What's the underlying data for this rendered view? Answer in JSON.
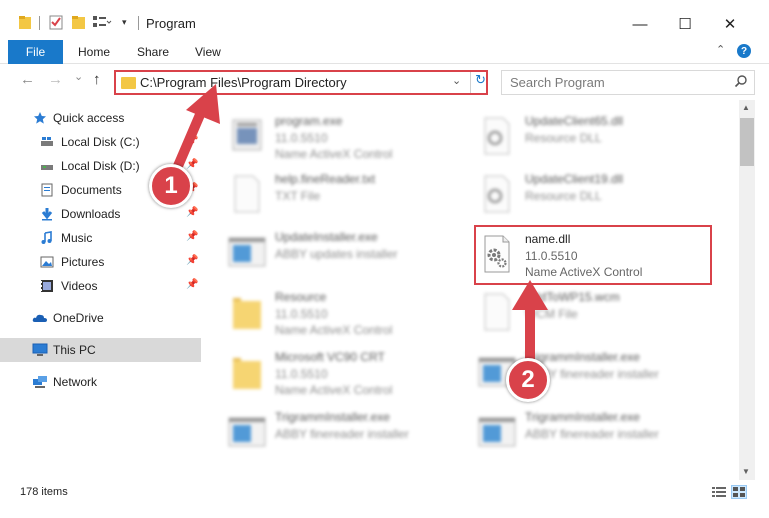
{
  "window": {
    "title": "Program",
    "minimize_glyph": "—",
    "maximize_glyph": "☐",
    "close_glyph": "✕"
  },
  "ribbon": {
    "tabs": [
      "File",
      "Home",
      "Share",
      "View"
    ]
  },
  "nav": {
    "back_glyph": "←",
    "forward_glyph": "→",
    "recent_glyph": "⌄",
    "up_glyph": "↑",
    "address": "C:\\Program Files\\Program Directory",
    "search_placeholder": "Search Program"
  },
  "sidebar": {
    "items": [
      {
        "label": "Quick access",
        "icon": "star-icon",
        "pinned": false
      },
      {
        "label": "Local Disk (C:)",
        "icon": "drive-icon",
        "pinned": true
      },
      {
        "label": "Local Disk (D:)",
        "icon": "drive-icon",
        "pinned": true
      },
      {
        "label": "Documents",
        "icon": "documents-icon",
        "pinned": true
      },
      {
        "label": "Downloads",
        "icon": "downloads-icon",
        "pinned": true
      },
      {
        "label": "Music",
        "icon": "music-icon",
        "pinned": true
      },
      {
        "label": "Pictures",
        "icon": "pictures-icon",
        "pinned": true
      },
      {
        "label": "Videos",
        "icon": "videos-icon",
        "pinned": true
      },
      {
        "label": "OneDrive",
        "icon": "cloud-icon",
        "pinned": false
      },
      {
        "label": "This PC",
        "icon": "computer-icon",
        "pinned": false
      },
      {
        "label": "Network",
        "icon": "network-icon",
        "pinned": false
      }
    ],
    "pin_glyph": "📌"
  },
  "files": {
    "left": [
      {
        "name": "program.exe",
        "line2": "11.0.5510",
        "line3": "Name ActiveX Control",
        "icon": "exe-icon"
      },
      {
        "name": "help.fineReader.txt",
        "line2": "TXT File",
        "line3": "",
        "icon": "text-file-icon"
      },
      {
        "name": "UpdateInstaller.exe",
        "line2": "ABBY updates installer",
        "line3": "",
        "icon": "installer-icon"
      },
      {
        "name": "Resource",
        "line2": "11.0.5510",
        "line3": "Name ActiveX Control",
        "icon": "folder-icon"
      },
      {
        "name": "Microsoft VC90 CRT",
        "line2": "11.0.5510",
        "line3": "Name ActiveX Control",
        "icon": "folder-icon"
      },
      {
        "name": "TrigrammInstaller.exe",
        "line2": "ABBY finereader installer",
        "line3": "",
        "icon": "installer-icon"
      }
    ],
    "right": [
      {
        "name": "UpdateClient65.dll",
        "line2": "Resource DLL",
        "line3": "",
        "icon": "dll-icon"
      },
      {
        "name": "UpdateClient19.dll",
        "line2": "Resource DLL",
        "line3": "",
        "icon": "dll-icon"
      },
      {
        "name": "name.dll",
        "line2": "11.0.5510",
        "line3": "Name ActiveX Control",
        "icon": "dll-gear-icon"
      },
      {
        "name": "AddToWP15.wcm",
        "line2": "WCM File",
        "line3": "",
        "icon": "file-icon"
      },
      {
        "name": "TrigrammInstaller.exe",
        "line2": "ABBY finereader installer",
        "line3": "",
        "icon": "installer-icon"
      },
      {
        "name": "TrigrammInstaller.exe",
        "line2": "ABBY finereader installer",
        "line3": "",
        "icon": "installer-icon"
      }
    ]
  },
  "status": {
    "item_count": "178 items"
  },
  "callouts": [
    "1",
    "2"
  ],
  "colors": {
    "accent": "#1979ca",
    "highlight": "#d9424a",
    "selected": "#cce8ff"
  }
}
